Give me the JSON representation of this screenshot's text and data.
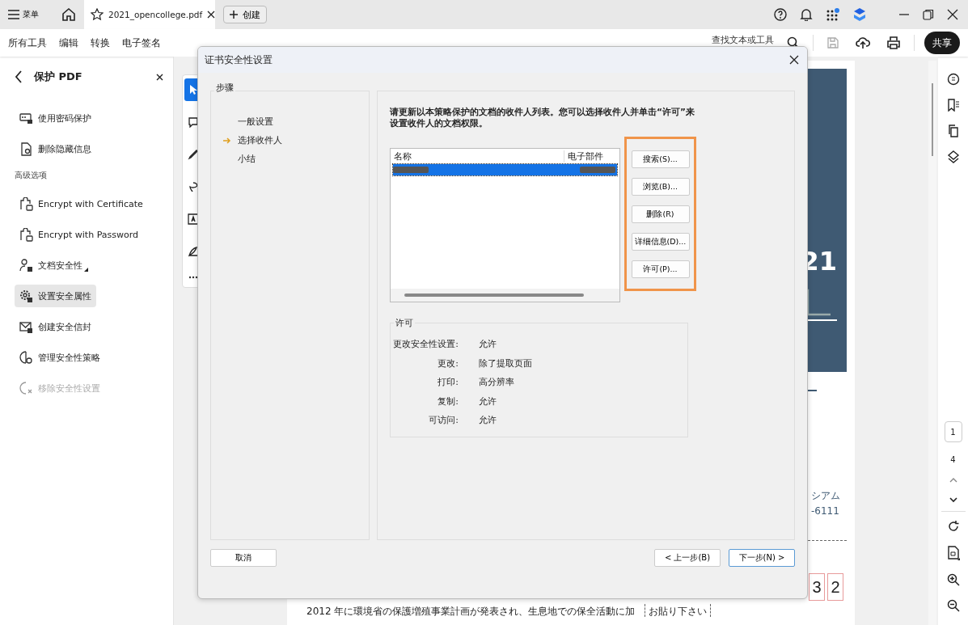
{
  "top_bar": {
    "menu_label": "菜单",
    "tab_title": "2021_opencollege.pdf",
    "new_button": "创建"
  },
  "toolbar": {
    "tabs": [
      "所有工具",
      "编辑",
      "转换",
      "电子签名"
    ],
    "search_label": "查找文本或工具",
    "share_button": "共享"
  },
  "sidebar": {
    "title": "保护 PDF",
    "items": [
      {
        "label": "使用密码保护",
        "selected": false,
        "disabled": false
      },
      {
        "label": "删除隐藏信息",
        "selected": false,
        "disabled": false
      }
    ],
    "section_label": "高级选项",
    "advanced_items": [
      {
        "label": "Encrypt with Certificate",
        "selected": false,
        "disabled": false,
        "submenu": false
      },
      {
        "label": "Encrypt with Password",
        "selected": false,
        "disabled": false,
        "submenu": false
      },
      {
        "label": "文档安全性",
        "selected": false,
        "disabled": false,
        "submenu": true
      },
      {
        "label": "设置安全属性",
        "selected": true,
        "disabled": false,
        "submenu": false
      },
      {
        "label": "创建安全信封",
        "selected": false,
        "disabled": false,
        "submenu": false
      },
      {
        "label": "管理安全性策略",
        "selected": false,
        "disabled": false,
        "submenu": false
      },
      {
        "label": "移除安全性设置",
        "selected": false,
        "disabled": true,
        "submenu": false
      }
    ]
  },
  "tool_strip": {
    "tools": [
      {
        "selected": true
      },
      {
        "selected": false
      },
      {
        "selected": false
      },
      {
        "selected": false
      },
      {
        "selected": false
      },
      {
        "selected": false
      }
    ]
  },
  "document": {
    "cover_number": "21",
    "contact_lines": [
      "シアム",
      "-6111"
    ],
    "digit_boxes": [
      "3",
      "2"
    ],
    "body_text": "2012 年に環境省の保護増殖事業計画が発表され、生息地での保全活動に加",
    "stamp_note": "お貼り下さい"
  },
  "right_rail": {
    "current_page": "1",
    "page_count": "4"
  },
  "dialog": {
    "title": "证书安全性设置",
    "steps_legend": "步骤",
    "steps": [
      {
        "label": "一般设置",
        "current": false
      },
      {
        "label": "选择收件人",
        "current": true
      },
      {
        "label": "小结",
        "current": false
      }
    ],
    "instruction": "请更新以本策略保护的文档的收件人列表。您可以选择收件人并单击“许可”来设置收件人的文档权限。",
    "recipients": {
      "columns": [
        "名称",
        "电子部件"
      ],
      "rows": [
        {
          "selected": true
        }
      ]
    },
    "button_group": {
      "highlighted": true,
      "buttons": [
        "搜索(S)...",
        "浏览(B)...",
        "删除(R)",
        "详细信息(D)...",
        "许可(P)..."
      ]
    },
    "permissions": {
      "legend": "许可",
      "rows": [
        {
          "label": "更改安全性设置:",
          "value": "允许"
        },
        {
          "label": "更改:",
          "value": "除了提取页面"
        },
        {
          "label": "打印:",
          "value": "高分辨率"
        },
        {
          "label": "复制:",
          "value": "允许"
        },
        {
          "label": "可访问:",
          "value": "允许"
        }
      ]
    },
    "footer": [
      {
        "label": "取消",
        "default": false
      },
      {
        "label": "< 上一步(B)",
        "default": false
      },
      {
        "label": "下一步(N) >",
        "default": true
      }
    ]
  }
}
